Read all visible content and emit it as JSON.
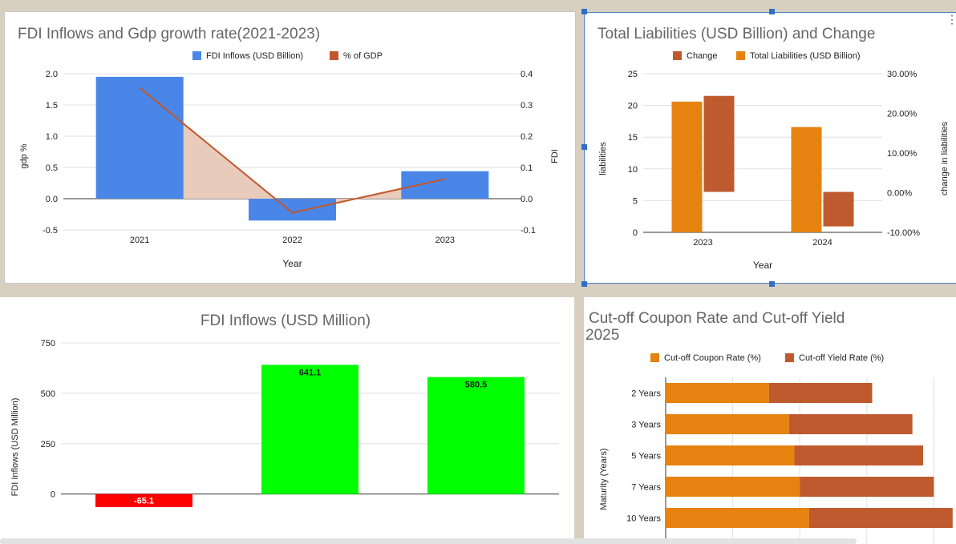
{
  "chart_data": [
    {
      "id": "fdi-gdp",
      "type": "bar+line",
      "title": "FDI Inflows and Gdp growth rate(2021-2023)",
      "xlabel": "Year",
      "ylabel_left": "gdp %",
      "ylabel_right": "FDI",
      "categories": [
        "2021",
        "2022",
        "2023"
      ],
      "left_ticks": [
        "2.0",
        "1.5",
        "1.0",
        "0.5",
        "0.0",
        "-0.5"
      ],
      "right_ticks": [
        "0.4",
        "0.3",
        "0.2",
        "0.1",
        "0.0",
        "-0.1"
      ],
      "ylim_left": [
        -0.5,
        2.0
      ],
      "ylim_right": [
        -0.1,
        0.4
      ],
      "series": [
        {
          "name": "FDI Inflows (USD Billion)",
          "type": "bar",
          "axis": "left",
          "color": "#4a86e8",
          "values": [
            1.95,
            -0.35,
            0.44
          ]
        },
        {
          "name": "% of GDP",
          "type": "line",
          "axis": "right",
          "color": "#c0572d",
          "values": [
            0.355,
            -0.045,
            0.063
          ]
        }
      ]
    },
    {
      "id": "liabilities",
      "type": "bar",
      "title": "Total Liabilities (USD Billion) and Change",
      "xlabel": "Year",
      "ylabel_left": "liabilities",
      "ylabel_right": "change in liabilities",
      "categories": [
        "2023",
        "2024"
      ],
      "left_ticks": [
        "25",
        "20",
        "15",
        "10",
        "5",
        "0"
      ],
      "right_ticks": [
        "30.00%",
        "20.00%",
        "10.00%",
        "0.00%",
        "-10.00%"
      ],
      "ylim_left": [
        0,
        25
      ],
      "ylim_right": [
        -10,
        30
      ],
      "legend": [
        "Change",
        "Total Liabilities (USD Billion)"
      ],
      "series": [
        {
          "name": "Total Liabilities (USD Billion)",
          "axis": "left",
          "color": "#e6820f",
          "values": [
            20.6,
            16.6
          ]
        },
        {
          "name": "Change",
          "axis": "right",
          "color": "#bf5a2e",
          "values": [
            [
              0.2,
              24.4
            ],
            [
              -8.5,
              0.2
            ]
          ]
        }
      ]
    },
    {
      "id": "fdi-million",
      "type": "bar",
      "title": "FDI Inflows (USD Million)",
      "xlabel": "",
      "ylabel": "FDI Inflows (USD Million)",
      "categories": [
        "",
        "",
        ""
      ],
      "values": [
        -65.1,
        641.1,
        580.5
      ],
      "labels": [
        "-65.1",
        "641.1",
        "580.5"
      ],
      "colors": [
        "#ff0000",
        "#00ff00",
        "#00ff00"
      ],
      "ticks": [
        "750",
        "500",
        "250",
        "0"
      ],
      "ylim": [
        -65,
        750
      ]
    },
    {
      "id": "coupon-yield",
      "type": "bar",
      "orientation": "horizontal",
      "stacked": true,
      "title": "Cut-off Coupon Rate  and Cut-off Yield 2025",
      "title_lines": [
        "Cut-off Coupon Rate  and Cut-off Yield",
        "2025"
      ],
      "ylabel": "Maturity (Years)",
      "categories": [
        "2 Years",
        "3 Years",
        "5 Years",
        "7 Years",
        "10 Years"
      ],
      "xlim": [
        0,
        25
      ],
      "series": [
        {
          "name": "Cut-off Coupon Rate (%)",
          "color": "#e6820f",
          "values": [
            7.7,
            9.2,
            9.6,
            10.0,
            10.7
          ]
        },
        {
          "name": "Cut-off Yield Rate (%)",
          "color": "#bf5a2e",
          "values": [
            7.7,
            9.2,
            9.6,
            10.0,
            10.7
          ]
        }
      ]
    }
  ]
}
